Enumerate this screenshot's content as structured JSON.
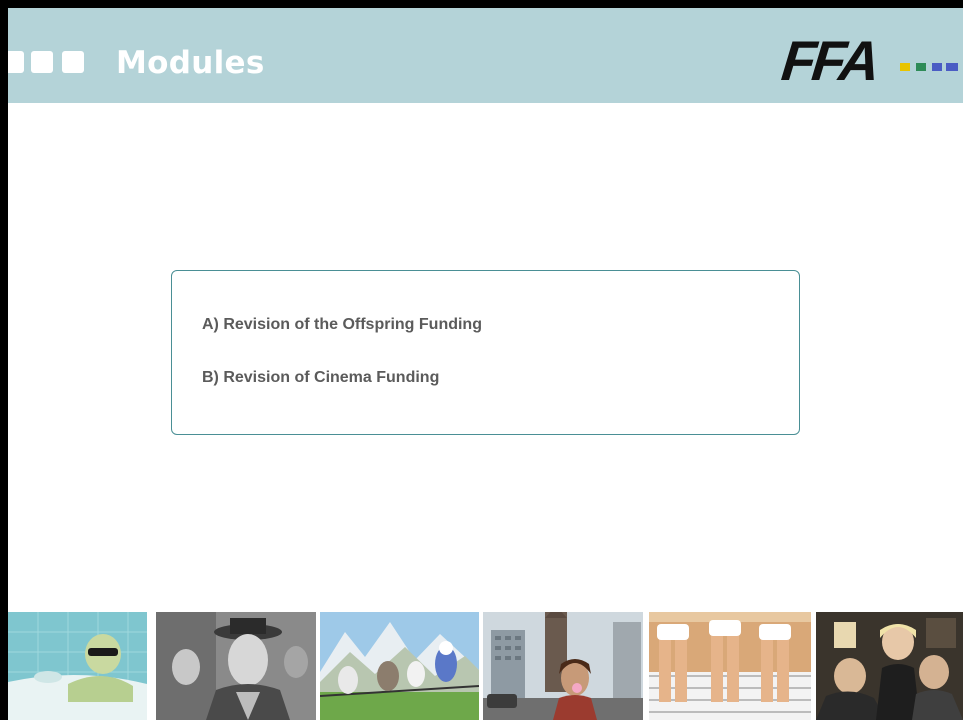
{
  "header": {
    "title": "Modules",
    "logo_text": "FFA",
    "background_color": "#b4d3d8",
    "title_color": "#ffffff"
  },
  "logo": {
    "icon": "ffa-logo",
    "dot_colors": [
      "#e8c400",
      "#2e8b57",
      "#4a5cc4",
      "#4a5cc4"
    ]
  },
  "content": {
    "items": [
      {
        "label": "A) Revision of the Offspring Funding"
      },
      {
        "label": "B) Revision of Cinema Funding"
      }
    ],
    "border_color": "#4a8f95",
    "text_color": "#5b5b5b"
  },
  "filmstrip": {
    "frames": [
      {
        "icon": "bathtub-photo"
      },
      {
        "icon": "portrait-hat-photo"
      },
      {
        "icon": "animated-birds-photo"
      },
      {
        "icon": "city-street-photo"
      },
      {
        "icon": "balcony-legs-photo"
      },
      {
        "icon": "group-portrait-photo"
      }
    ]
  }
}
